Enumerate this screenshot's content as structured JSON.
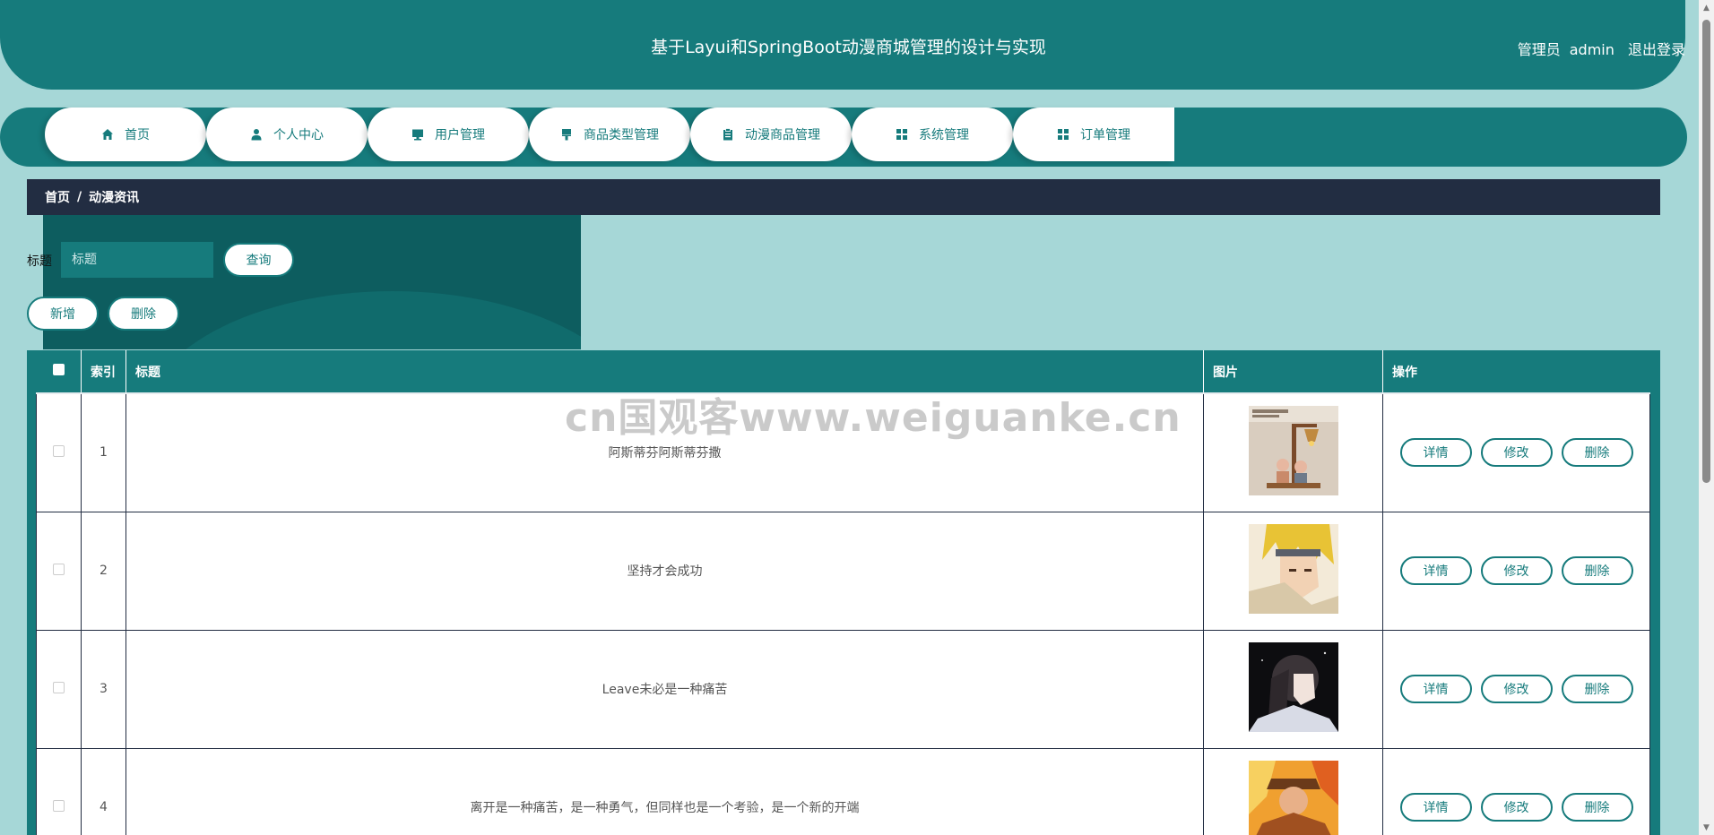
{
  "header": {
    "title": "基于Layui和SpringBoot动漫商城管理的设计与实现",
    "user_role": "管理员",
    "user_name": "admin",
    "logout_label": "退出登录"
  },
  "nav": {
    "items": [
      {
        "label": "首页",
        "icon": "home-icon"
      },
      {
        "label": "个人中心",
        "icon": "user-icon"
      },
      {
        "label": "用户管理",
        "icon": "monitor-icon"
      },
      {
        "label": "商品类型管理",
        "icon": "brush-icon"
      },
      {
        "label": "动漫商品管理",
        "icon": "clipboard-icon"
      },
      {
        "label": "系统管理",
        "icon": "grid-icon"
      },
      {
        "label": "订单管理",
        "icon": "grid-icon"
      }
    ]
  },
  "breadcrumb": {
    "home": "首页",
    "separator": "/",
    "current": "动漫资讯"
  },
  "search": {
    "label": "标题",
    "placeholder": "标题",
    "value": "",
    "button_label": "查询"
  },
  "actions": {
    "add_label": "新增",
    "delete_label": "删除"
  },
  "table": {
    "headers": [
      "",
      "索引",
      "标题",
      "图片",
      "操作"
    ],
    "rows": [
      {
        "index": "1",
        "title": "阿斯蒂芬阿斯蒂芬撒",
        "image": "lamp-figurine-thumbnail"
      },
      {
        "index": "2",
        "title": "坚持才会成功",
        "image": "anime-blonde-character-thumbnail"
      },
      {
        "index": "3",
        "title": "Leave未必是一种痛苦",
        "image": "anime-dark-haired-girl-thumbnail"
      },
      {
        "index": "4",
        "title": "离开是一种痛苦，是一种勇气，但同样也是一个考验，是一个新的开端",
        "image": "anime-fire-character-thumbnail"
      }
    ],
    "row_actions": {
      "detail": "详情",
      "edit": "修改",
      "delete": "删除"
    }
  },
  "watermark": "cn国观客www.weiguanke.cn",
  "colors": {
    "primary": "#167b7c",
    "background": "#a6d7d7",
    "breadcrumb_bg": "#222d42",
    "deco_dark": "#0d5d5f"
  }
}
